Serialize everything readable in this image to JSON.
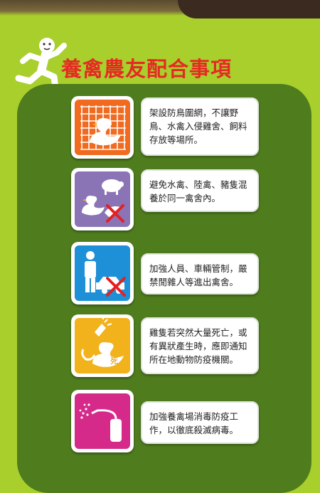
{
  "title": "養禽農友配合事項",
  "items": [
    {
      "icon": "duck-behind-net-icon",
      "color": "#f06a20",
      "text": "架設防鳥圍網，不讓野鳥、水禽入侵雞舍、飼料存放等場所。"
    },
    {
      "icon": "duck-pig-no-mixing-icon",
      "color": "#8a74b6",
      "text": "避免水禽、陸禽、豬隻混養於同一禽舍內。"
    },
    {
      "icon": "person-car-no-entry-icon",
      "color": "#1e90d8",
      "text": "加強人員、車輛管制，嚴禁閒雜人等進出禽舍。"
    },
    {
      "icon": "dead-duck-alert-icon",
      "color": "#f2b21c",
      "icon_label": "死",
      "text": "雞隻若突然大量死亡，或有異狀產生時，應即通知所在地動物防疫機關。"
    },
    {
      "icon": "disinfectant-sprayer-icon",
      "color": "#d52a8a",
      "text": "加強養禽場消毒防疫工作，以徹底殺滅病毒。"
    }
  ]
}
